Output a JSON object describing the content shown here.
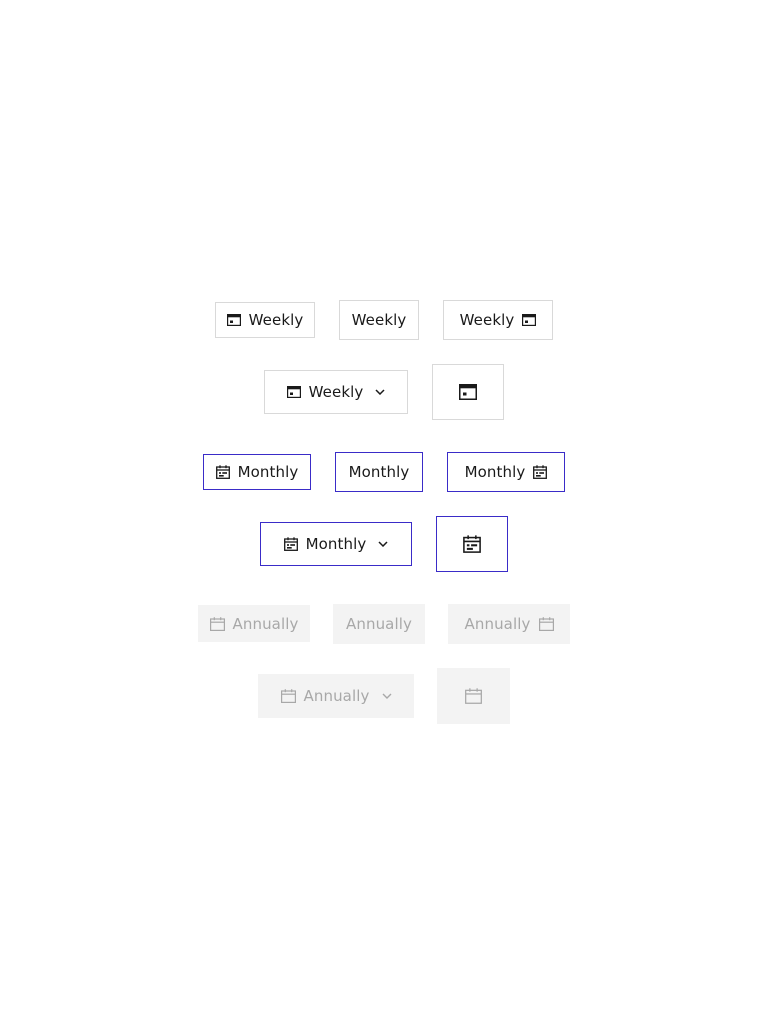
{
  "weekly_group": {
    "icon": "calendar-week-icon",
    "label_left_icon": "Weekly",
    "label_plain": "Weekly",
    "label_right_icon": "Weekly",
    "label_dropdown": "Weekly",
    "chevron_icon": "chevron-down-icon"
  },
  "monthly_group": {
    "icon": "calendar-month-icon",
    "label_left_icon": "Monthly",
    "label_plain": "Monthly",
    "label_right_icon": "Monthly",
    "label_dropdown": "Monthly",
    "chevron_icon": "chevron-down-icon"
  },
  "annual_group": {
    "icon": "calendar-icon",
    "label_left_icon": "Annually",
    "label_plain": "Annually",
    "label_right_icon": "Annually",
    "label_dropdown": "Annually",
    "chevron_icon": "chevron-down-icon",
    "state": "disabled"
  },
  "colors": {
    "primary": "#3a2cc8",
    "text": "#1a1a1a",
    "disabled_text": "#a8a8a8",
    "disabled_bg": "#f3f3f3",
    "default_border": "#d9d9d9"
  }
}
